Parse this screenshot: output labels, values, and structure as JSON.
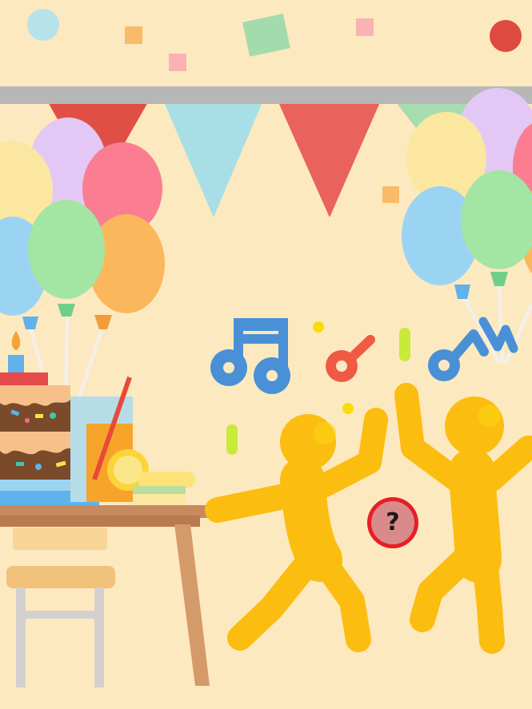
{
  "scene": {
    "background_color": "#fde9bf",
    "bunting_colors": [
      "#e04f44",
      "#a8dfe6",
      "#e9625c",
      "#a6dcb0"
    ],
    "balloon_colors": [
      "#e3c8f5",
      "#fa7d92",
      "#fbe7a0",
      "#9bd4f3",
      "#a3e5a3",
      "#fbb75c"
    ],
    "figure_color": "#fbbd10",
    "music_colors": [
      "#4a90d6",
      "#ef5a44"
    ]
  },
  "hint_button": {
    "label": "?",
    "icon": "question-mark-icon",
    "ring_color": "#e51f26",
    "fill_color": "#d98a8a"
  }
}
